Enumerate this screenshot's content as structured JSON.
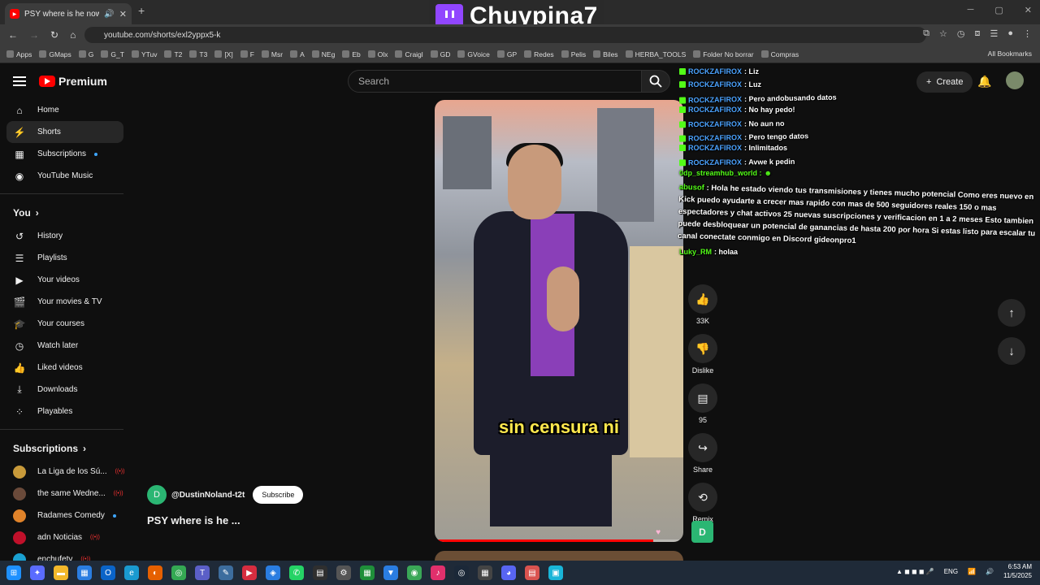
{
  "browser": {
    "tab_title": "PSY where is he now #fyp",
    "url": "youtube.com/shorts/exl2yppx5-k",
    "bookmarks": [
      "Apps",
      "GMaps",
      "G",
      "G_T",
      "YTuv",
      "T2",
      "T3",
      "[X]",
      "F",
      "Msr",
      "A",
      "NEg",
      "Eb",
      "Olx",
      "Craigl",
      "GD",
      "GVoice",
      "GP",
      "Redes",
      "Pelis",
      "Biles",
      "HERBA_TOOLS",
      "Folder No borrar",
      "Compras"
    ],
    "all_bookmarks": "All Bookmarks"
  },
  "stream_overlay": {
    "channel": "Chuypina7"
  },
  "header": {
    "logo": "Premium",
    "search_placeholder": "Search",
    "create_label": "Create"
  },
  "sidebar": {
    "main": [
      {
        "label": "Home",
        "icon": "home-icon"
      },
      {
        "label": "Shorts",
        "icon": "shorts-icon",
        "active": true
      },
      {
        "label": "Subscriptions",
        "icon": "subscriptions-icon",
        "dot": true
      },
      {
        "label": "YouTube Music",
        "icon": "music-icon"
      }
    ],
    "you_title": "You",
    "you": [
      {
        "label": "History",
        "icon": "history-icon"
      },
      {
        "label": "Playlists",
        "icon": "playlists-icon"
      },
      {
        "label": "Your videos",
        "icon": "your-videos-icon"
      },
      {
        "label": "Your movies & TV",
        "icon": "movies-icon"
      },
      {
        "label": "Your courses",
        "icon": "courses-icon"
      },
      {
        "label": "Watch later",
        "icon": "watch-later-icon"
      },
      {
        "label": "Liked videos",
        "icon": "like-icon"
      },
      {
        "label": "Downloads",
        "icon": "download-icon"
      },
      {
        "label": "Playables",
        "icon": "playables-icon"
      }
    ],
    "subs_title": "Subscriptions",
    "subs": [
      {
        "label": "La Liga de los Sú...",
        "live": true,
        "color": "#c89a3a"
      },
      {
        "label": "the same Wedne...",
        "live": true,
        "color": "#6a4a3a"
      },
      {
        "label": "Radames Comedy",
        "dot": true,
        "color": "#e0832a"
      },
      {
        "label": "adn Noticias",
        "live": true,
        "color": "#c0102a"
      },
      {
        "label": "enchufetv",
        "live": true,
        "color": "#1aa0d0"
      }
    ]
  },
  "video": {
    "caption": "sin censura ni",
    "channel_initial": "D",
    "channel_name": "@DustinNoland-t2t",
    "subscribe_label": "Subscribe",
    "title": "PSY where is he ...",
    "progress": 0.88
  },
  "actions": {
    "likes": "33K",
    "dislike": "Dislike",
    "comments": "95",
    "share": "Share",
    "remix": "Remix"
  },
  "chat": {
    "lines": [
      {
        "nick": "ROCKZAFIROX",
        "msg": ": Liz"
      },
      {
        "nick": "ROCKZAFIROX",
        "msg": ": Luz"
      },
      {
        "nick": "ROCKZAFIROX",
        "msg": ": Pero andobusando datos"
      },
      {
        "nick": "ROCKZAFIROX",
        "msg": ": No hay pedo!"
      },
      {
        "nick": "ROCKZAFIROX",
        "msg": ": No aun no"
      },
      {
        "nick": "ROCKZAFIROX",
        "msg": ": Pero tengo datos"
      },
      {
        "nick": "ROCKZAFIROX",
        "msg": ": Inlimitados"
      },
      {
        "nick": "ROCKZAFIROX",
        "msg": ": Avwe k pedin"
      }
    ],
    "hub_nick": "0dp_streamhub_world :",
    "long_nick": "abusof",
    "long_msg": ": Hola he estado viendo tus transmisiones y tienes mucho potencial Como eres nuevo en Kick puedo ayudarte a crecer mas rapido con mas de 500 seguidores reales 150 o mas espectadores y chat activos 25 nuevas suscripciones y verificacion en 1 a 2 meses Esto tambien puede desbloquear un potencial de ganancias de hasta 200 por hora Si estas listo para escalar tu canal conectate conmigo en Discord gideonpro1",
    "last_nick": "Luky_RM",
    "last_msg": ": holaa"
  },
  "taskbar": {
    "lang": "ENG",
    "time": "6:53 AM",
    "date": "11/5/2025"
  }
}
